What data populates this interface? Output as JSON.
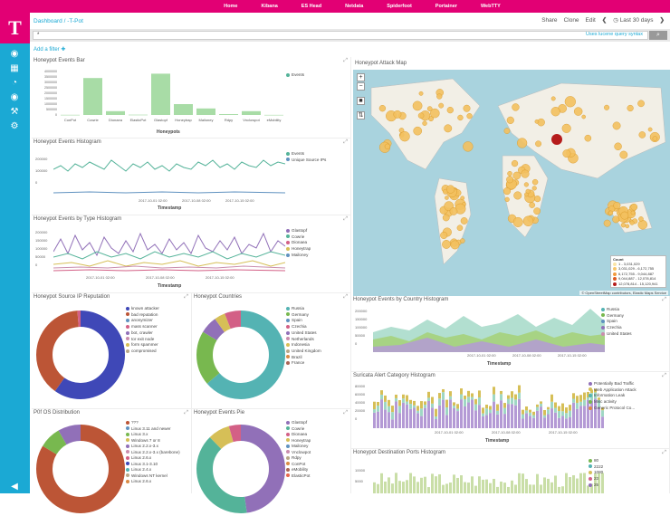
{
  "topnav": {
    "items": [
      "Home",
      "Kibana",
      "ES Head",
      "Netdata",
      "Spiderfoot",
      "Portainer",
      "WebTTY"
    ]
  },
  "sidebar": {
    "logo": "T"
  },
  "breadcrumb": "Dashboard / -T-Pot",
  "toolbar": {
    "share": "Share",
    "clone": "Clone",
    "edit": "Edit",
    "prev": "❮",
    "time": "◷ Last 30 days",
    "next": "❯"
  },
  "search": {
    "value": "*",
    "lucene": "Uses lucene query syntax",
    "button": "⌕"
  },
  "add_filter": "Add a filter ✚",
  "panels": {
    "bar": {
      "title": "Honeypot Events Bar",
      "xlabel": "Honeypots",
      "legend": [
        "Events"
      ]
    },
    "histo": {
      "title": "Honeypot Events Histogram",
      "xlabel": "Timestamp",
      "legend": [
        "Events",
        "Unique Source IPs"
      ],
      "xticks": [
        "2017-10-01 02:00",
        "2017-10-08 02:00",
        "2017-10-15 02:00"
      ],
      "yticks": [
        "200000",
        "100000",
        "0"
      ]
    },
    "type_histo": {
      "title": "Honeypot Events by Type Histogram",
      "xlabel": "Timestamp",
      "legend": [
        "Glastopf",
        "Cowrie",
        "Dionaea",
        "Honeytrap",
        "Mailoney"
      ],
      "xticks": [
        "2017-10-01 02:00",
        "2017-10-08 02:00",
        "2017-10-15 02:00"
      ],
      "yticks": [
        "200000",
        "150000",
        "100000",
        "50000",
        "0"
      ]
    },
    "map": {
      "title": "Honeypot Attack Map",
      "legend_title": "Count",
      "legend": [
        "1 - 3,031,029",
        "3,031,029 - 6,172,755",
        "6,172,755 - 9,044,887",
        "9,044,887 - 12,078,814",
        "12,078,814 - 15,120,941"
      ],
      "attribution": "© OpenStreetMap contributors, Elastic Maps Service"
    },
    "rep": {
      "title": "Honeypot Source IP Reputation",
      "legend": [
        "known attacker",
        "bad reputation",
        "anonymizer",
        "mass scanner",
        "bot, crawler",
        "tor exit node",
        "form spammer",
        "compromised"
      ]
    },
    "countries": {
      "title": "Honeypot Countries",
      "legend": [
        "Russia",
        "Germany",
        "Spain",
        "Czechia",
        "United States",
        "Netherlands",
        "Indonesia",
        "United Kingdom",
        "Brazil",
        "France"
      ]
    },
    "country_histo": {
      "title": "Honeypot Events by Country Histogram",
      "xlabel": "Timestamp",
      "legend": [
        "Russia",
        "Germany",
        "Spain",
        "Czechia",
        "United States"
      ],
      "xticks": [
        "2017-10-01 02:00",
        "2017-10-08 02:00",
        "2017-10-15 02:00"
      ],
      "yticks": [
        "200000",
        "150000",
        "100000",
        "50000",
        "0"
      ]
    },
    "suricata": {
      "title": "Suricata Alert Category Histogram",
      "xlabel": "Timestamp",
      "legend": [
        "Potentially Bad Traffic",
        "Web Application Attack",
        "Information Leak",
        "Misc activity",
        "Generic Protocol Co..."
      ],
      "xticks": [
        "2017-10-01 02:00",
        "2017-10-08 02:00",
        "2017-10-15 02:00"
      ],
      "yticks": [
        "80000",
        "60000",
        "40000",
        "20000",
        "0"
      ]
    },
    "p0f": {
      "title": "P0f OS Distribution",
      "legend": [
        "???",
        "Linux 3.11 and newer",
        "Linux 3.x",
        "Windows 7 or 8",
        "Linux 2.2.x-3.x",
        "Linux 2.2.x-3.x (barebone)",
        "Linux 2.6.x",
        "Linux 3.1-3.10",
        "Linux 2.4.x",
        "Windows NT kernel",
        "Linux 2.6.x"
      ]
    },
    "pie": {
      "title": "Honeypot Events Pie",
      "legend": [
        "Glastopf",
        "Cowrie",
        "Dionaea",
        "Honeytrap",
        "Mailoney",
        "Vnclowpot",
        "Rdpy",
        "ConPot",
        "eMobility",
        "ElasticPot"
      ]
    },
    "ports": {
      "title": "Honeypot Destination Ports Histogram",
      "legend": [
        "80",
        "2222",
        "1080",
        "23",
        "25"
      ],
      "yticks": [
        "10000",
        "5000",
        "0"
      ]
    }
  },
  "colors": {
    "magenta": "#e20074",
    "teal": "#1ba9d4",
    "green": "#54b399",
    "bar": "#a8dca6"
  },
  "chart_data": [
    {
      "type": "bar",
      "title": "Honeypot Events Bar",
      "categories": [
        "ConPot",
        "Cowrie",
        "Dionaea",
        "ElasticPot",
        "Glastopf",
        "Honeytrap",
        "Mailoney",
        "Rdpy",
        "Vnclowpot",
        "eMobility"
      ],
      "values": [
        15000,
        3400000,
        350000,
        25000,
        3800000,
        1000000,
        600000,
        80000,
        350000,
        10000
      ],
      "ylim": [
        0,
        4000000
      ],
      "yticks": [
        "4000000",
        "3500000",
        "3000000",
        "2500000",
        "2000000",
        "1500000",
        "1000000",
        "500000",
        "0"
      ],
      "xlabel": "Honeypots",
      "legend": [
        "Events"
      ]
    }
  ]
}
